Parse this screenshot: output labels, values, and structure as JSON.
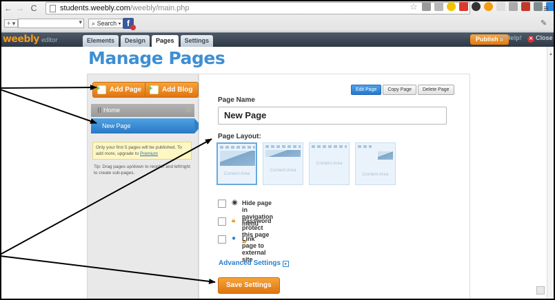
{
  "browser": {
    "url_host": "students.weebly.com",
    "url_path": "/weebly/main.php",
    "search_label": "Search",
    "toolbar_small": "+ ▾"
  },
  "app": {
    "logo": "weebly",
    "logo_suffix": "editor",
    "tabs": [
      {
        "label": "Elements"
      },
      {
        "label": "Design"
      },
      {
        "label": "Pages"
      },
      {
        "label": "Settings"
      }
    ],
    "publish_label": "Publish »",
    "help_label": "Help!",
    "close_label": "Close"
  },
  "page": {
    "title": "Manage Pages",
    "add_page_label": "Add Page",
    "add_blog_label": "Add Blog",
    "pages": [
      {
        "label": "Home"
      },
      {
        "label": "New Page"
      }
    ],
    "notice_text": "Only your first 5 pages will be published. To add more, upgrade to ",
    "notice_link": "Premium",
    "tip_text": "Tip: Drag pages up/down to reorder and left/right to create sub-pages."
  },
  "editor": {
    "edit_page_label": "Edit Page",
    "copy_page_label": "Copy Page",
    "delete_page_label": "Delete Page",
    "page_name_label": "Page Name",
    "page_name_value": "New Page",
    "page_layout_label": "Page Layout:",
    "layout_caption": "Content Area",
    "options": [
      {
        "label": "Hide page in navigation menu"
      },
      {
        "label": "Password protect this page"
      },
      {
        "label": "Link page to external site"
      }
    ],
    "advanced_label": "Advanced Settings",
    "save_label": "Save Settings"
  }
}
